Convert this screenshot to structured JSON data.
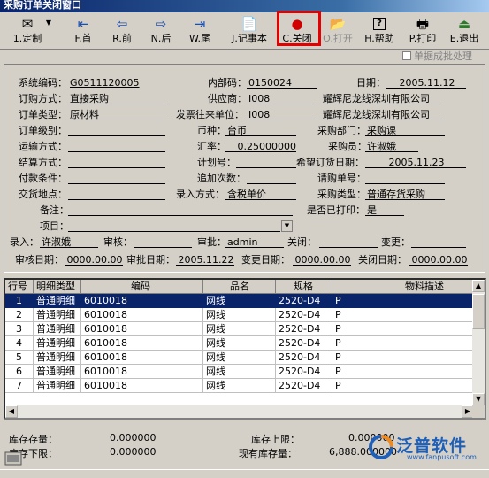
{
  "window": {
    "title": "采购订单关闭窗口"
  },
  "toolbar": {
    "buttons": [
      {
        "label": "1.定制",
        "icon": "✉"
      },
      {
        "label": "F.首",
        "icon": "⇤"
      },
      {
        "label": "R.前",
        "icon": "⇦"
      },
      {
        "label": "N.后",
        "icon": "⇨"
      },
      {
        "label": "W.尾",
        "icon": "⇥"
      },
      {
        "label": "J.记事本",
        "icon": "📄"
      },
      {
        "label": "C.关闭",
        "icon": "●"
      },
      {
        "label": "O.打开",
        "icon": "📂"
      },
      {
        "label": "H.帮助",
        "icon": "?"
      },
      {
        "label": "P.打印",
        "icon": "🖶"
      },
      {
        "label": "E.退出",
        "icon": "⏏"
      }
    ],
    "batch_checkbox": "单据成批处理"
  },
  "form": {
    "sys_no_label": "系统编码：",
    "sys_no": "G0511120005",
    "inner_no_label": "内部码：",
    "inner_no": "0150024",
    "date_label": "日期：",
    "date": "2005.11.12",
    "order_type_label": "订购方式：",
    "order_type": "直接采购",
    "supplier_label": "供应商：",
    "supplier_code": "I008",
    "supplier_name": "耀辉尼龙线深圳有限公司",
    "bill_type_label": "订单类型：",
    "bill_type": "原材料",
    "invoice_unit_label": "发票往来单位：",
    "invoice_unit_code": "I008",
    "invoice_unit_name": "耀辉尼龙线深圳有限公司",
    "level_label": "订单级别：",
    "level": "",
    "currency_label": "币种：",
    "currency": "台币",
    "dept_label": "采购部门：",
    "dept": "采购课",
    "transport_label": "运输方式：",
    "transport": "",
    "rate_label": "汇率：",
    "rate": "0.25000000",
    "buyer_label": "采购员：",
    "buyer": "许淑娥",
    "settle_label": "结算方式：",
    "settle": "",
    "plan_label": "计划号：",
    "plan": "",
    "hope_date_label": "希望订货日期：",
    "hope_date": "2005.11.23",
    "pay_label": "付款条件：",
    "pay": "",
    "times_label": "追加次数：",
    "times": "",
    "req_label": "请购单号：",
    "req": "",
    "deliver_label": "交货地点：",
    "deliver": "",
    "entry_label": "录入方式：",
    "entry": "含税单价",
    "ptype_label": "采购类型：",
    "ptype": "普通存货采购",
    "note_label": "备注：",
    "note": "",
    "printed_label": "是否已打印：",
    "printed": "是",
    "project_label": "项目：",
    "project": "",
    "input_by_label": "录入：",
    "input_by": "许淑娥",
    "audit_label": "审核：",
    "audit": "",
    "approve_label": "审批：",
    "approve": "admin",
    "close_label": "关闭：",
    "close": "",
    "change_label": "变更：",
    "change": "",
    "audit_date_label": "审核日期：",
    "audit_date": "0000.00.00",
    "approve_date_label": "审批日期：",
    "approve_date": "2005.11.22",
    "change_date_label": "变更日期：",
    "change_date": "0000.00.00",
    "close_date_label": "关闭日期：",
    "close_date": "0000.00.00"
  },
  "grid": {
    "columns": [
      "行号",
      "明细类型",
      "编码",
      "品名",
      "规格",
      "物料描述"
    ],
    "rows": [
      [
        "1",
        "普通明细",
        "6010018",
        "网线",
        "2520-D4",
        "P"
      ],
      [
        "2",
        "普通明细",
        "6010018",
        "网线",
        "2520-D4",
        "P"
      ],
      [
        "3",
        "普通明细",
        "6010018",
        "网线",
        "2520-D4",
        "P"
      ],
      [
        "4",
        "普通明细",
        "6010018",
        "网线",
        "2520-D4",
        "P"
      ],
      [
        "5",
        "普通明细",
        "6010018",
        "网线",
        "2520-D4",
        "P"
      ],
      [
        "6",
        "普通明细",
        "6010018",
        "网线",
        "2520-D4",
        "P"
      ],
      [
        "7",
        "普通明细",
        "6010018",
        "网线",
        "2520-D4",
        "P"
      ]
    ]
  },
  "stock": {
    "stock_qty_label": "库存存量：",
    "stock_qty": "0.000000",
    "upper_label": "库存上限：",
    "upper": "0.000000",
    "lower_label": "库存下限：",
    "lower": "0.000000",
    "current_label": "现有库存量：",
    "current": "6,888.000000"
  },
  "brand": {
    "name": "泛普软件",
    "url": "www.fanpusoft.com"
  }
}
